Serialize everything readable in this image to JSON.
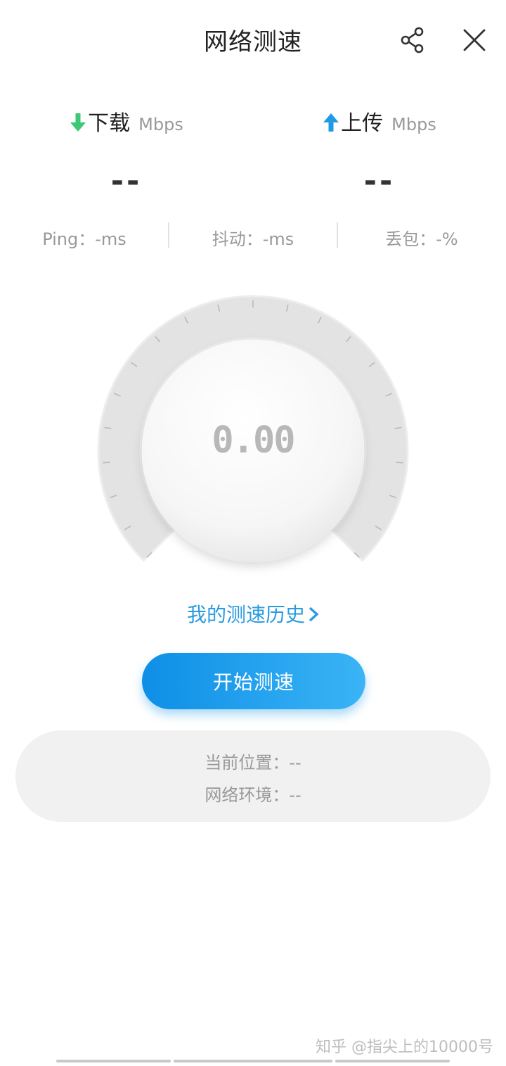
{
  "header": {
    "title": "网络测速",
    "share_icon": "share-icon",
    "close_icon": "close-icon"
  },
  "download": {
    "label": "下载",
    "unit": "Mbps",
    "value": "--",
    "icon": "arrow-down-icon",
    "color": "#3cc874"
  },
  "upload": {
    "label": "上传",
    "unit": "Mbps",
    "value": "--",
    "icon": "arrow-up-icon",
    "color": "#1f9be6"
  },
  "stats": {
    "ping": "Ping：-ms",
    "jitter": "抖动：-ms",
    "loss": "丢包：-%"
  },
  "gauge": {
    "value": "0.00"
  },
  "history_link": "我的测速历史",
  "start_button": "开始测速",
  "info": {
    "location": "当前位置：--",
    "network": "网络环境：--"
  },
  "watermark": "知乎 @指尖上的10000号",
  "colors": {
    "accent": "#1f9be6",
    "link": "#2a9be0",
    "download_arrow": "#3cc874"
  }
}
